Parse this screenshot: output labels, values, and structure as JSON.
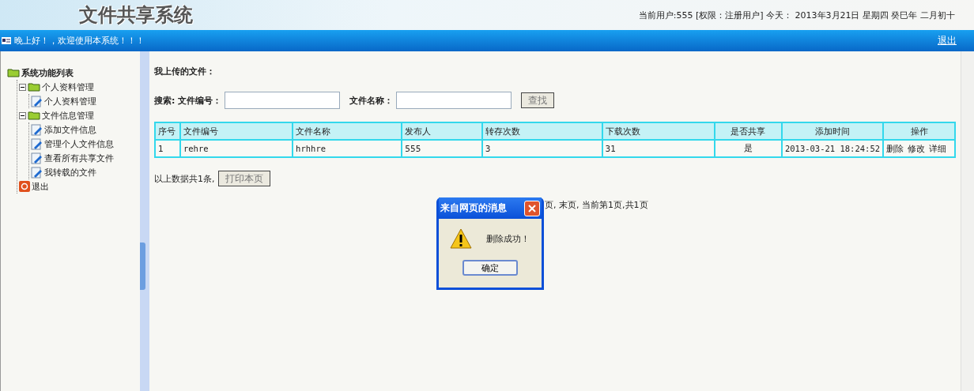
{
  "header": {
    "logo": "文件共享系统",
    "user_info": "当前用户:555 [权限：注册用户] 今天： 2013年3月21日 星期四 癸巳年 二月初十"
  },
  "nav_bar": {
    "greeting": "晚上好！，欢迎使用本系统！！！",
    "logout": "退出"
  },
  "sidebar": {
    "tree": [
      {
        "label": "系统功能列表",
        "kind": "folder",
        "children": [
          {
            "label": "个人资料管理",
            "kind": "folder",
            "expanded": true,
            "children": [
              {
                "label": "个人资料管理",
                "kind": "page"
              }
            ]
          },
          {
            "label": "文件信息管理",
            "kind": "folder",
            "expanded": true,
            "children": [
              {
                "label": "添加文件信息",
                "kind": "page"
              },
              {
                "label": "管理个人文件信息",
                "kind": "page"
              },
              {
                "label": "查看所有共享文件",
                "kind": "page"
              },
              {
                "label": "我转载的文件",
                "kind": "page"
              }
            ]
          },
          {
            "label": "退出",
            "kind": "exit"
          }
        ]
      }
    ]
  },
  "content": {
    "title": "我上传的文件：",
    "search": {
      "label": "搜索:",
      "fields": [
        {
          "label": "文件编号："
        },
        {
          "label": "文件名称："
        }
      ],
      "button": "查找"
    },
    "table": {
      "columns": [
        "序号",
        "文件编号",
        "文件名称",
        "发布人",
        "转存次数",
        "下载次数",
        "是否共享",
        "添加时间",
        "操作"
      ],
      "rows": [
        {
          "cells": [
            "1",
            "rehre",
            "hrhhre",
            "555",
            "3",
            "31",
            "是",
            "2013-03-21 18:24:52"
          ],
          "actions": [
            "删除",
            "修改",
            "详细"
          ]
        }
      ]
    },
    "summary": "以上数据共1条,",
    "print_button": "打印本页",
    "pagination": "页, 末页, 当前第1页,共1页"
  },
  "dialog": {
    "title": "来自网页的消息",
    "message": "删除成功！",
    "ok_button": "确定"
  }
}
